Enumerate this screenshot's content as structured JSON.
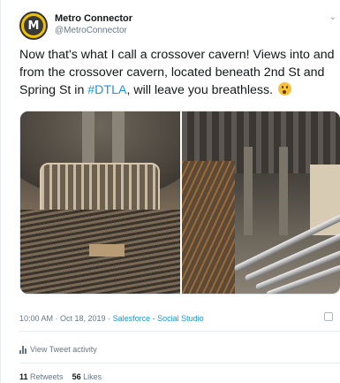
{
  "tweet": {
    "author_name": "Metro Connector",
    "author_handle": "@MetroConnector",
    "avatar_letter": "M",
    "text_part1": "Now that's what I call a crossover cavern! Views into and from the crossover cavern, located beneath 2nd St and Spring St in ",
    "hashtag": "#DTLA",
    "text_part2": ", will leave you breathless. ",
    "emoji": "astonished-face-emoji",
    "timestamp": "10:00 AM · Oct 18, 2019 · ",
    "source": "Salesforce - Social Studio",
    "activity_label": "View Tweet activity",
    "retweets_count": "11",
    "retweets_label": "Retweets",
    "likes_count": "56",
    "likes_label": "Likes"
  },
  "colors": {
    "link": "#1b95e0",
    "muted": "#657786",
    "avatar_bg": "#f2c200"
  }
}
